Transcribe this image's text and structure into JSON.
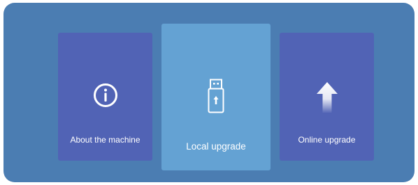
{
  "menu": {
    "items": [
      {
        "label": "About the machine",
        "icon": "info-icon",
        "selected": false
      },
      {
        "label": "Local upgrade",
        "icon": "usb-upgrade-icon",
        "selected": true
      },
      {
        "label": "Online upgrade",
        "icon": "upload-arrow-icon",
        "selected": false
      }
    ]
  },
  "colors": {
    "panel_background": "#4b7db2",
    "card_background": "#5163b5",
    "selected_card_background": "#64a2d3",
    "text": "#ffffff"
  }
}
